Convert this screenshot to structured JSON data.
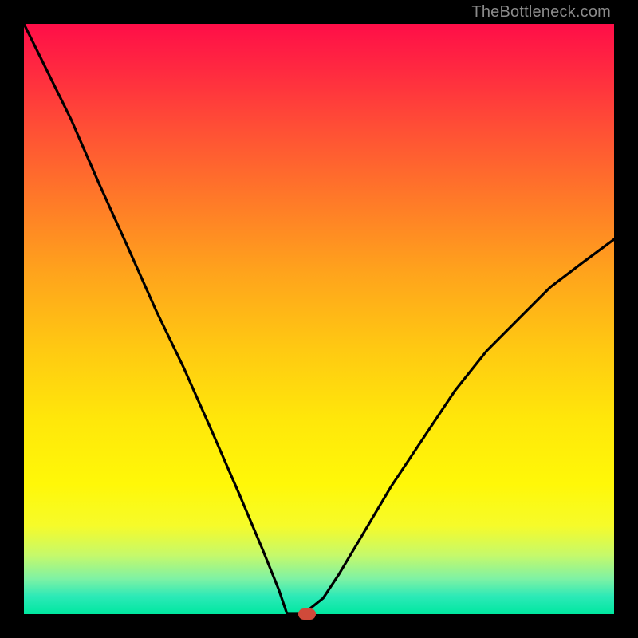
{
  "watermark": "TheBottleneck.com",
  "chart_data": {
    "type": "line",
    "title": "",
    "xlabel": "",
    "ylabel": "",
    "xlim": [
      0,
      100
    ],
    "ylim": [
      0,
      100
    ],
    "grid": false,
    "legend": false,
    "background_gradient": {
      "direction": "vertical",
      "stops": [
        {
          "pos": 0.0,
          "color": "#ff0e48"
        },
        {
          "pos": 0.3,
          "color": "#ff7a28"
        },
        {
          "pos": 0.55,
          "color": "#ffc912"
        },
        {
          "pos": 0.78,
          "color": "#fff808"
        },
        {
          "pos": 0.94,
          "color": "#7ff2a4"
        },
        {
          "pos": 1.0,
          "color": "#00e8a0"
        }
      ]
    },
    "series": [
      {
        "name": "bottleneck-curve",
        "color": "#000000",
        "x": [
          0.0,
          4.0,
          8.0,
          12.7,
          17.6,
          22.4,
          27.0,
          31.8,
          36.5,
          40.5,
          43.2,
          44.6,
          47.3,
          50.7,
          53.4,
          57.4,
          62.2,
          67.6,
          73.0,
          78.4,
          83.8,
          89.2,
          94.6,
          100.0
        ],
        "y": [
          100.0,
          91.9,
          83.8,
          73.0,
          62.2,
          51.4,
          41.9,
          31.1,
          20.3,
          10.8,
          4.1,
          0.0,
          0.0,
          2.7,
          6.8,
          13.5,
          21.6,
          29.7,
          37.8,
          44.6,
          50.0,
          55.4,
          59.5,
          63.5
        ]
      }
    ],
    "marker": {
      "name": "optimal-point",
      "x": 48.0,
      "y": 0.0,
      "color": "#d04a3a",
      "shape": "rounded-rect"
    }
  }
}
